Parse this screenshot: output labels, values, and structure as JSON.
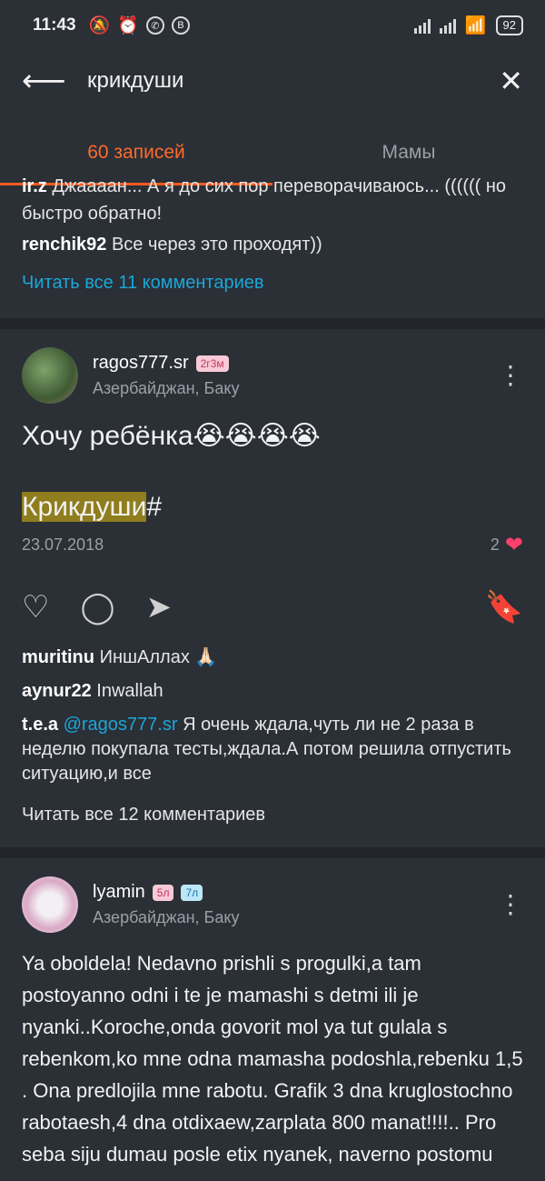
{
  "status_bar": {
    "time": "11:43",
    "left_icons": [
      "bell-off-icon",
      "alarm-icon",
      "whatsapp-icon",
      "b-icon"
    ],
    "battery": "92"
  },
  "search": {
    "back_icon": "arrow-left-icon",
    "query": "крикдуши",
    "close_icon": "close-icon"
  },
  "tabs": [
    {
      "label": "60 записей",
      "active": true
    },
    {
      "label": "Мамы",
      "active": false
    }
  ],
  "top_comments": {
    "partial_user": "ir.z",
    "partial_text": "Джаааан... А я до сих пор переворачиваюсь... (((((( но быстро обратно!",
    "user": "renchik92",
    "text": "Все через это проходят))",
    "read_all": "Читать все 11 комментариев"
  },
  "post1": {
    "username": "ragos777.sr",
    "badge": "2г3м",
    "location": "Азербайджан, Баку",
    "text": "Хочу ребёнка😭😭😭😭",
    "hashtag_highlight": "Крикдуши",
    "hashtag_suffix": "#",
    "date": "23.07.2018",
    "likes": "2",
    "comments": [
      {
        "user": "muritinu",
        "text": "ИншАллах 🙏🏻"
      },
      {
        "user": "aynur22",
        "text": "Inwallah"
      },
      {
        "user": "t.e.a",
        "mention": "@ragos777.sr",
        "text": "Я очень ждала,чуть ли не 2 раза в неделю покупала тесты,ждала.А потом решила отпустить ситуацию,и все"
      }
    ],
    "read_all": "Читать все 12 комментариев"
  },
  "post2": {
    "username": "lyamin",
    "badge1": "5л",
    "badge2": "7л",
    "location": "Азербайджан, Баку",
    "text": "Ya oboldela! Nedavno prishli s progulki,a tam postoyanno odni i te je mamashi s detmi ili je nyanki..Koroche,onda govorit mol ya tut gulala s rebenkom,ko mne odna mamasha podoshla,rebenku 1,5 . Ona predlojila mne rabotu. Grafik 3 dna kruglostochno rabotaesh,4 dna otdixaew,zarplata 800 manat!!!!.. Pro seba siju dumau posle etix nyanek, naverno postomu"
  },
  "colors": {
    "background": "#2b2f36",
    "accent": "#ff5a1f",
    "link": "#1aa7d8",
    "like": "#ff3f6c",
    "highlight": "#8f7d1e"
  }
}
